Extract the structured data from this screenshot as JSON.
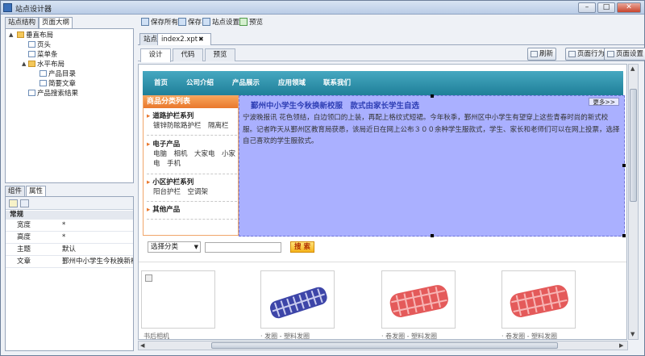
{
  "window": {
    "title": "站点设计器",
    "minimize": "–",
    "maximize": "□",
    "close": "✕"
  },
  "left_panel": {
    "tabs": [
      "站点结构",
      "页面大纲"
    ],
    "tree": {
      "root": "垂直布局",
      "children": [
        "页头",
        "菜单条",
        "水平布局"
      ],
      "subchildren": [
        "产品目录",
        "简要文章"
      ],
      "last": "产品搜索结果"
    }
  },
  "bottom_panel": {
    "tabs": [
      "组件",
      "属性"
    ],
    "category": "常规",
    "props": [
      {
        "k": "宽度",
        "v": "*"
      },
      {
        "k": "高度",
        "v": "*"
      },
      {
        "k": "主题",
        "v": "默认"
      },
      {
        "k": "文章",
        "v": "鄞州中小学生今秋换新校服"
      }
    ]
  },
  "toolbar": {
    "save_all": "保存所有",
    "save": "保存",
    "site_settings": "站点设置",
    "preview": "预览"
  },
  "doc_tabs": {
    "site": "站点",
    "file": "index2.xpt",
    "close": "✖"
  },
  "view_tabs": {
    "design": "设计",
    "code": "代码",
    "preview": "预览"
  },
  "right_buttons": {
    "refresh": "刷新",
    "page_behavior": "页面行为",
    "page_settings": "页面设置"
  },
  "page": {
    "nav": [
      "首页",
      "公司介绍",
      "产品展示",
      "应用领域",
      "联系我们"
    ],
    "category_title": "商品分类列表",
    "categories": [
      {
        "title": "道路护栏系列",
        "items": "镀锌防眩路护栏　隔离栏"
      },
      {
        "title": "电子产品",
        "items": "电脑　相机　大家电　小家电　手机"
      },
      {
        "title": "小区护栏系列",
        "items": "阳台护栏　空调架"
      },
      {
        "title": "其他产品",
        "items": ""
      }
    ],
    "news_title": "鄞州中小学生今秋换新校服　款式由家长学生自选",
    "more": "更多>>",
    "news_body": "宁波晚报讯 花色领结，白边领口的上装，再配上格纹式短裙。今年秋季，鄞州区中小学生有望穿上这些青春时尚的新式校服。记者昨天从鄞州区教育局获悉，该局近日在网上公布３００余种学生服款式，学生、家长和老师们可以在网上投票，选择自己喜欢的学生服款式。",
    "search": {
      "select": "选择分类",
      "button": "搜 索"
    },
    "products": [
      "书后相机",
      "· 发圈 - 塑料发圈",
      "· 卷发圈 - 塑料发圈",
      "· 卷发圈 - 塑料发圈"
    ],
    "colors": {
      "nav": "#2a8da7",
      "cat_head": "#ee8a3a",
      "selection": "#aab0ff",
      "news_title": "#2f3fb5"
    }
  }
}
